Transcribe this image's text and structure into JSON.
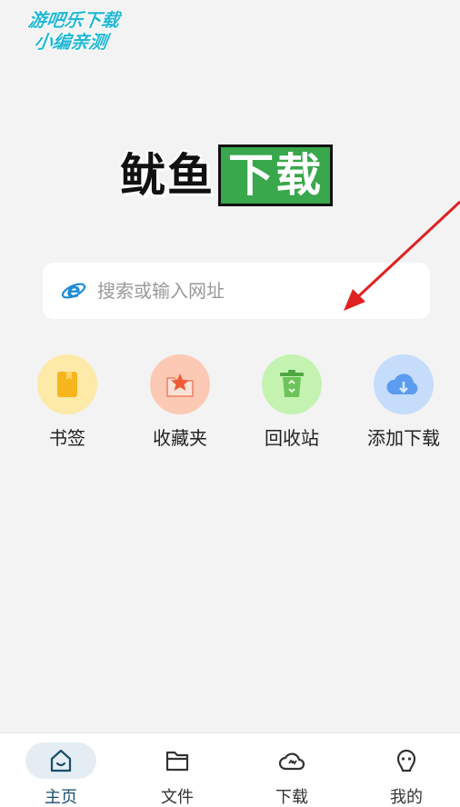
{
  "watermark": {
    "line1": "游吧乐下载",
    "line2": "小编亲测"
  },
  "logo": {
    "left_text": "鱿鱼",
    "right_text": "下载"
  },
  "search": {
    "placeholder": "搜索或输入网址"
  },
  "quick_actions": [
    {
      "label": "书签",
      "icon": "bookmark-icon",
      "color": "#fde9a8"
    },
    {
      "label": "收藏夹",
      "icon": "star-folder-icon",
      "color": "#fcc9b4"
    },
    {
      "label": "回收站",
      "icon": "recycle-bin-icon",
      "color": "#c4f3b1"
    },
    {
      "label": "添加下载",
      "icon": "cloud-download-icon",
      "color": "#c5dcfb"
    }
  ],
  "bottom_nav": [
    {
      "label": "主页",
      "icon": "home-icon",
      "active": true
    },
    {
      "label": "文件",
      "icon": "folder-icon",
      "active": false
    },
    {
      "label": "下载",
      "icon": "cloud-icon",
      "active": false
    },
    {
      "label": "我的",
      "icon": "user-icon",
      "active": false
    }
  ],
  "colors": {
    "background": "#f3f3f3",
    "brand_green": "#39a74b",
    "active_nav": "#1a4d6b",
    "annotation_arrow": "#e02020"
  }
}
